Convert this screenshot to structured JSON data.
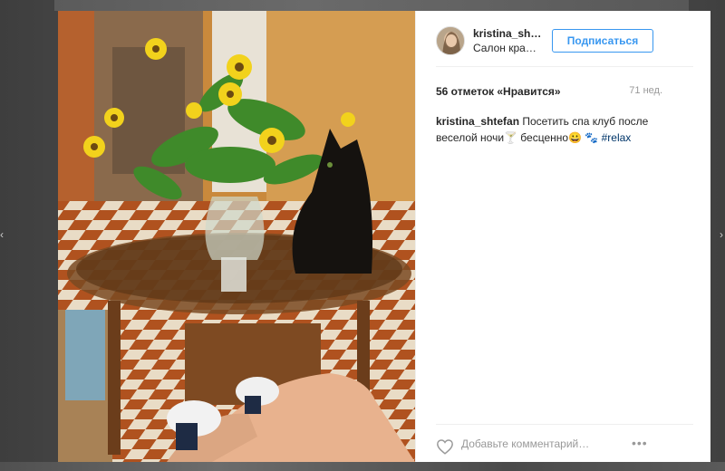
{
  "post": {
    "username": "kristina_sh…",
    "location": "Салон кра…",
    "follow_label": "Подписаться",
    "likes": "56 отметок «Нравится»",
    "age": "71 нед.",
    "caption_author": "kristina_shtefan",
    "caption_text": " Посетить спа клуб после веселой ночи🍸 бесценно😀 🐾 ",
    "caption_tag": "#relax",
    "comment_placeholder": "Добавьте комментарий…",
    "more_label": "•••"
  },
  "icons": {
    "heart": "heart-icon",
    "more": "more-options-icon",
    "prev": "chevron-left-icon",
    "next": "chevron-right-icon"
  },
  "colors": {
    "accent": "#3897f0",
    "text": "#262626",
    "muted": "#999999",
    "hashtag": "#003569"
  }
}
